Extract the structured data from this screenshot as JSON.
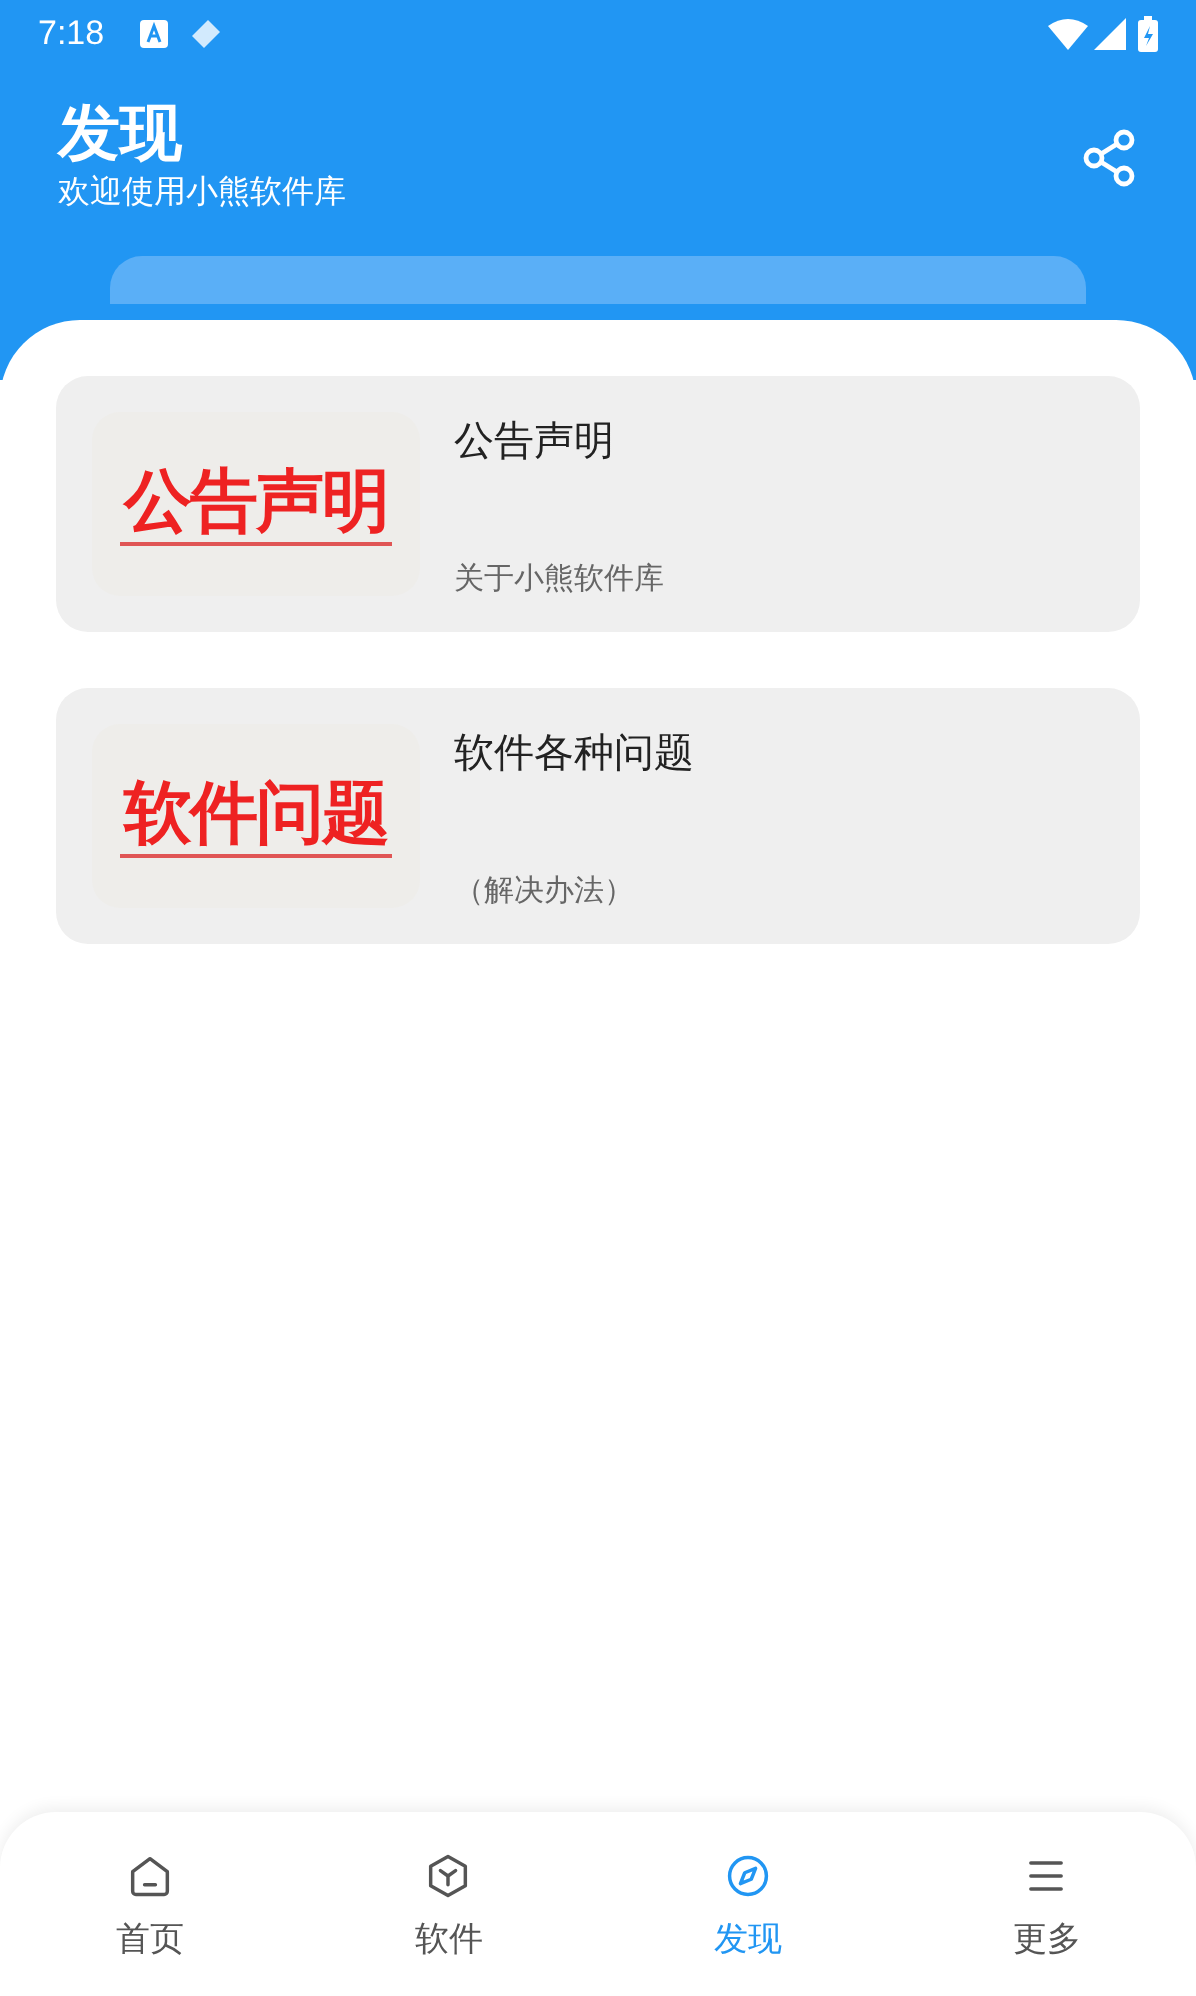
{
  "status_bar": {
    "time": "7:18"
  },
  "header": {
    "title": "发现",
    "subtitle": "欢迎使用小熊软件库"
  },
  "cards": [
    {
      "thumb_text": "公告声明",
      "title": "公告声明",
      "subtitle": "关于小熊软件库"
    },
    {
      "thumb_text": "软件问题",
      "title": "软件各种问题",
      "subtitle": "（解决办法）"
    }
  ],
  "nav": [
    {
      "kind": "home",
      "label": "首页",
      "selected": false
    },
    {
      "kind": "software",
      "label": "软件",
      "selected": false
    },
    {
      "kind": "discover",
      "label": "发现",
      "selected": true
    },
    {
      "kind": "more",
      "label": "更多",
      "selected": false
    }
  ]
}
